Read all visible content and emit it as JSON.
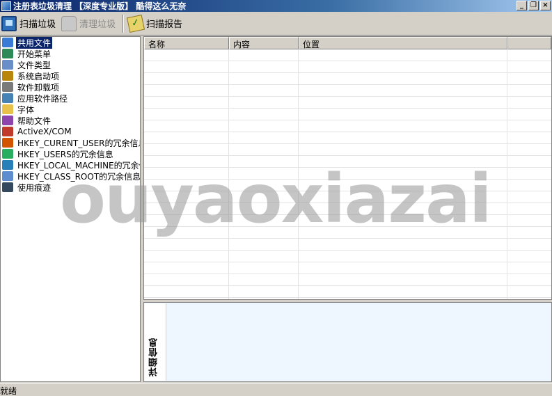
{
  "window": {
    "title": "注册表垃圾清理 【深度专业版】 酷得这么无奈",
    "controls": [
      "minimize",
      "restore",
      "close"
    ]
  },
  "toolbar": {
    "scan_label": "扫描垃圾",
    "clean_label": "清理垃圾",
    "report_label": "扫描报告"
  },
  "tree": {
    "items": [
      {
        "label": "共用文件",
        "icon": "shared-file-icon",
        "color": "#3a7bd5"
      },
      {
        "label": "开始菜单",
        "icon": "start-menu-icon",
        "color": "#2e8b57"
      },
      {
        "label": "文件类型",
        "icon": "file-type-icon",
        "color": "#6a8fc8"
      },
      {
        "label": "系统启动项",
        "icon": "startup-icon",
        "color": "#b8860b"
      },
      {
        "label": "软件卸载项",
        "icon": "uninstall-icon",
        "color": "#7a7a7a"
      },
      {
        "label": "应用软件路径",
        "icon": "app-path-icon",
        "color": "#4682b4"
      },
      {
        "label": "字体",
        "icon": "font-folder-icon",
        "color": "#e8c14a"
      },
      {
        "label": "帮助文件",
        "icon": "help-book-icon",
        "color": "#8e44ad"
      },
      {
        "label": "ActiveX/COM",
        "icon": "activex-icon",
        "color": "#c0392b"
      },
      {
        "label": "HKEY_CURENT_USER的冗余信息",
        "icon": "user-icon",
        "color": "#d35400"
      },
      {
        "label": "HKEY_USERS的冗余信息",
        "icon": "users-icon",
        "color": "#27ae60"
      },
      {
        "label": "HKEY_LOCAL_MACHINE的冗余信息",
        "icon": "machine-icon",
        "color": "#2980b9"
      },
      {
        "label": "HKEY_CLASS_ROOT的冗余信息",
        "icon": "class-root-icon",
        "color": "#5d8ccf"
      },
      {
        "label": "使用痕迹",
        "icon": "trace-icon",
        "color": "#34495e"
      }
    ]
  },
  "list": {
    "columns": [
      "名称",
      "内容",
      "位置",
      ""
    ]
  },
  "detail": {
    "label": "详细信息"
  },
  "watermark": "ouyaoxiazai",
  "status": {
    "text": "就绪"
  }
}
